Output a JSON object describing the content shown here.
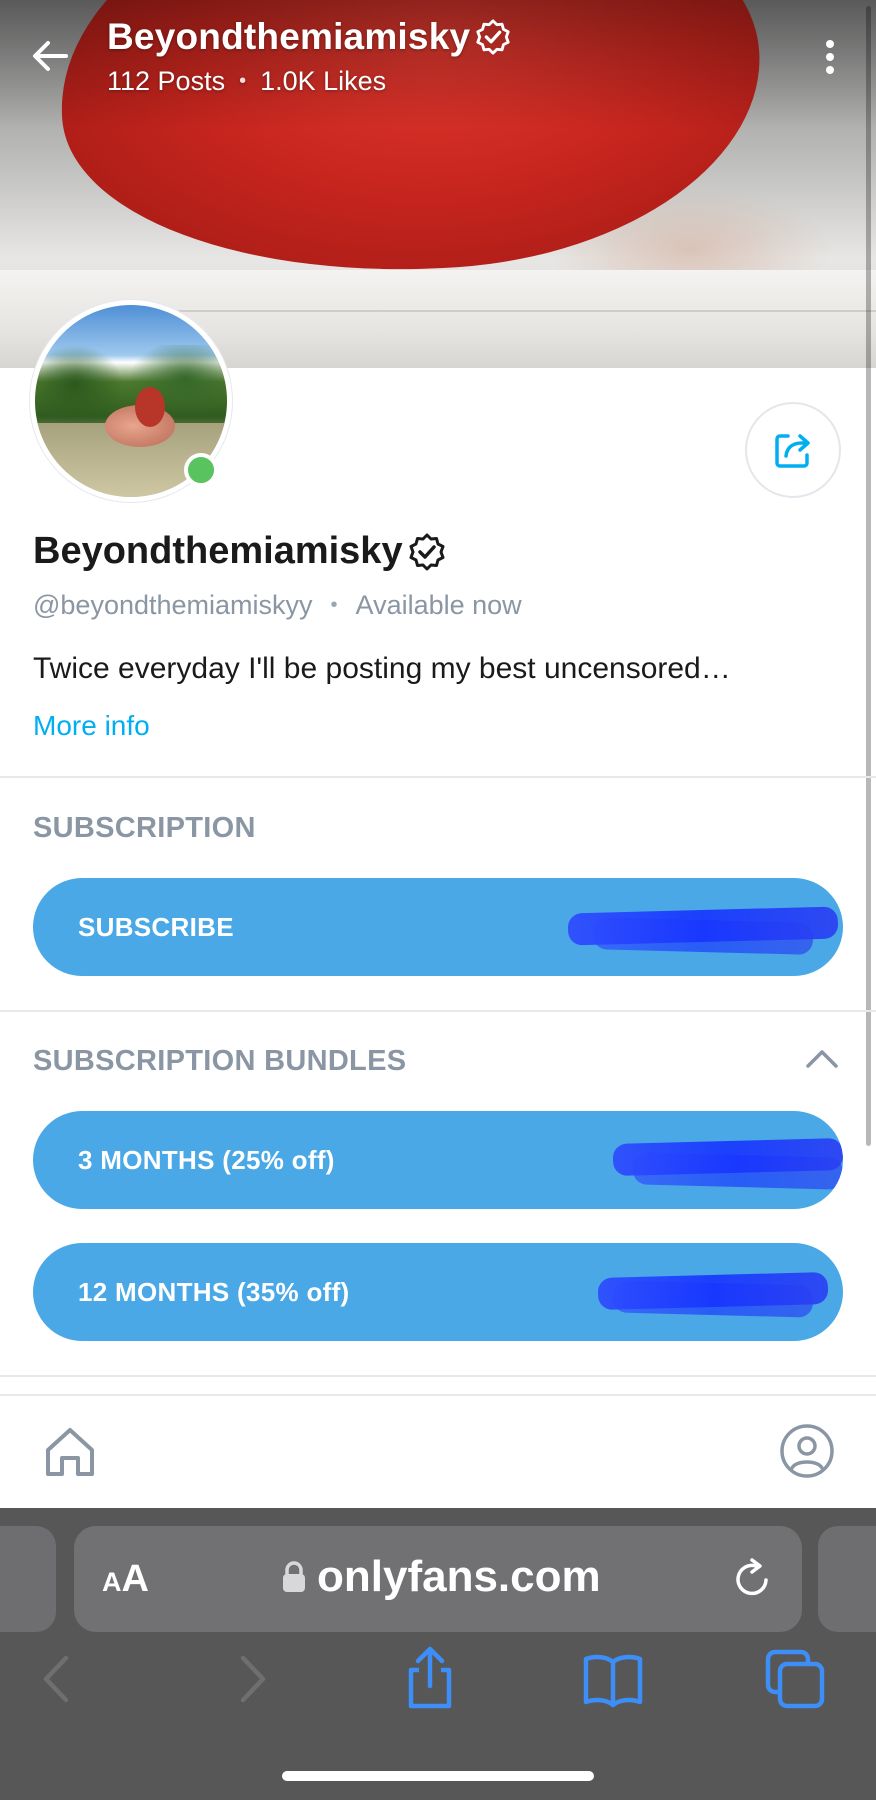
{
  "header": {
    "name": "Beyondthemiamisky",
    "posts": "112 Posts",
    "likes": "1.0K Likes"
  },
  "profile": {
    "name": "Beyondthemiamisky",
    "handle": "@beyondthemiamiskyy",
    "status": "Available now",
    "bio": "Twice everyday I'll be posting my best uncensored…",
    "more_info": "More info",
    "online": true
  },
  "subscription": {
    "title": "SUBSCRIPTION",
    "subscribe_label": "SUBSCRIBE"
  },
  "bundles": {
    "title": "SUBSCRIPTION BUNDLES",
    "expanded": true,
    "items": [
      {
        "label": "3 MONTHS (25% off)"
      },
      {
        "label": "12 MONTHS (35% off)"
      }
    ]
  },
  "browser": {
    "aa_label_small": "A",
    "aa_label_large": "A",
    "url": "onlyfans.com"
  },
  "colors": {
    "brand_blue": "#00aff0",
    "pill_blue": "#4aa8e6",
    "online_green": "#59c35f",
    "muted_text": "#8a96a3",
    "safari_dark": "#575758",
    "safari_blue": "#3d8ef7"
  },
  "icons": {
    "back": "arrow-left-icon",
    "menu": "kebab-menu-icon",
    "verified": "verified-badge-icon",
    "share": "share-icon",
    "chevron": "chevron-up-icon",
    "home": "home-icon",
    "profile": "profile-icon",
    "lock": "lock-icon",
    "reload": "reload-icon",
    "browser_back": "chevron-left-icon",
    "browser_forward": "chevron-right-icon",
    "browser_share": "share-up-icon",
    "bookmarks": "book-icon",
    "tabs": "tabs-icon"
  }
}
